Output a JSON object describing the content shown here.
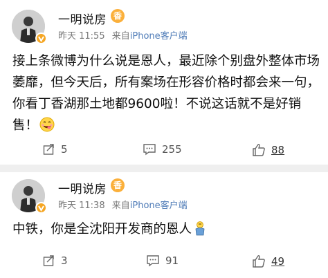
{
  "posts": [
    {
      "author": "一明说房",
      "author_tag": "香",
      "time": "昨天 11:55",
      "source_prefix": "来自",
      "source": "iPhone客户端",
      "text": "接上条微博为什么说是恩人，最近除个别盘外整体市场萎靡，但今天后，所有案场在形容价格时都会来一句，你看丁香湖那土地都9600啦！不说这话就不是好销售！",
      "emoji_icon": "yummy-face-emoji",
      "reposts": "5",
      "comments": "255",
      "likes": "88"
    },
    {
      "author": "一明说房",
      "author_tag": "香",
      "time": "昨天 11:38",
      "source_prefix": "来自",
      "source": "iPhone客户端",
      "text": "中铁，你是全沈阳开发商的恩人",
      "emoji_icon": "bowing-figure-emoji",
      "reposts": "3",
      "comments": "91",
      "likes": "49"
    }
  ],
  "colors": {
    "verified_badge": "#f5a623",
    "link": "#4e7bb7",
    "author_tag": "#fbb03b"
  }
}
